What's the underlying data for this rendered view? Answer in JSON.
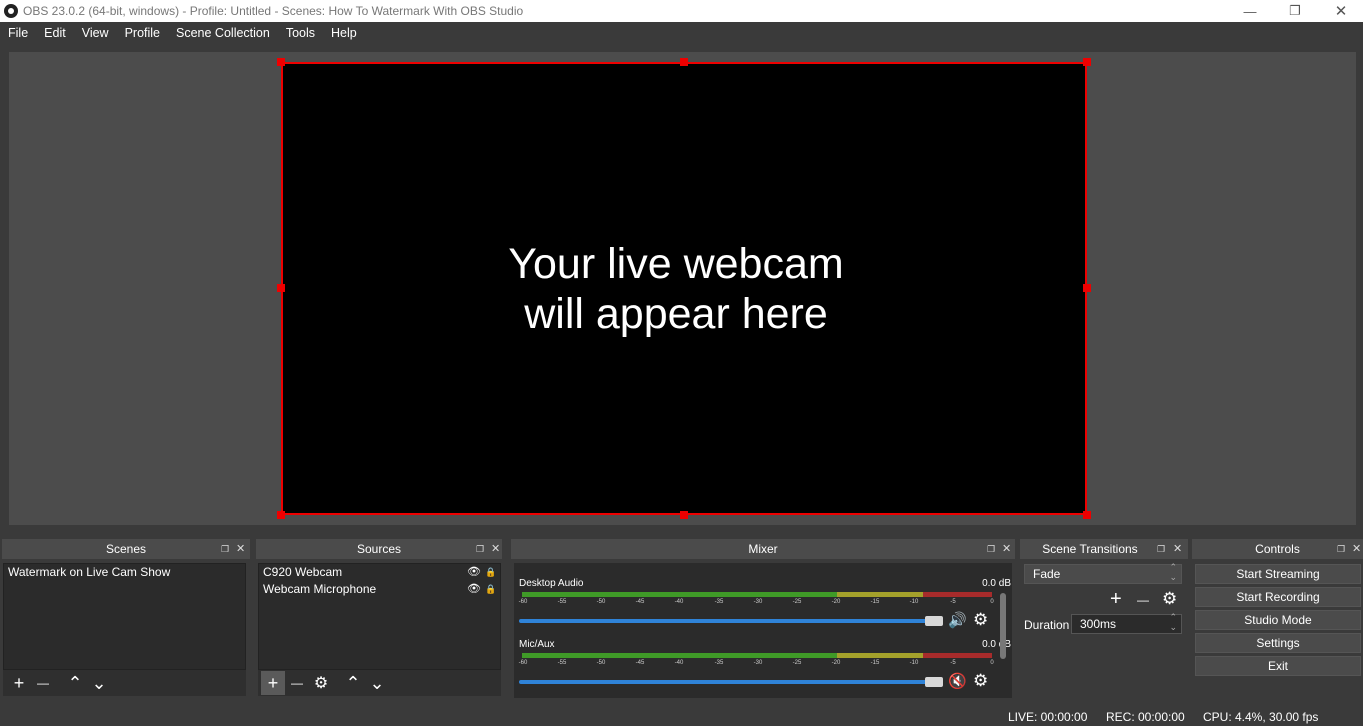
{
  "window": {
    "title": "OBS 23.0.2 (64-bit, windows) - Profile: Untitled - Scenes: How To Watermark With OBS Studio",
    "min_glyph": "—",
    "max_glyph": "❐",
    "close_glyph": "✕"
  },
  "menu": [
    "File",
    "Edit",
    "View",
    "Profile",
    "Scene Collection",
    "Tools",
    "Help"
  ],
  "preview": {
    "line1": "Your live webcam",
    "line2": "will appear here"
  },
  "scenes": {
    "title": "Scenes",
    "items": [
      "Watermark on Live Cam Show"
    ]
  },
  "sources": {
    "title": "Sources",
    "items": [
      "C920 Webcam",
      "Webcam Microphone"
    ]
  },
  "mixer": {
    "title": "Mixer",
    "ticks": [
      "-60",
      "-55",
      "-50",
      "-45",
      "-40",
      "-35",
      "-30",
      "-25",
      "-20",
      "-15",
      "-10",
      "-5",
      "0"
    ],
    "channels": [
      {
        "name": "Desktop Audio",
        "db": "0.0 dB",
        "muted": false
      },
      {
        "name": "Mic/Aux",
        "db": "0.0 dB",
        "muted": true
      }
    ]
  },
  "transitions": {
    "title": "Scene Transitions",
    "selected": "Fade",
    "duration_label": "Duration",
    "duration_value": "300ms"
  },
  "controls": {
    "title": "Controls",
    "start_streaming": "Start Streaming",
    "start_recording": "Start Recording",
    "studio_mode": "Studio Mode",
    "settings": "Settings",
    "exit": "Exit"
  },
  "status": {
    "live": "LIVE: 00:00:00",
    "rec": "REC: 00:00:00",
    "cpu": "CPU: 4.4%, 30.00 fps"
  },
  "icons": {
    "float": "❐",
    "close": "✕",
    "add": "+",
    "remove": "—",
    "up": "⌃",
    "down": "⌄",
    "gear": "⚙",
    "eye": "👁",
    "lock": "🔒",
    "speaker": "🔊",
    "muted": "🔇"
  },
  "colors": {
    "selection_red": "#ee0000",
    "meter_green": "#3f9a27",
    "meter_yellow": "#a4a12b",
    "meter_red": "#a72b2b",
    "slider_blue": "#2f83d8"
  }
}
